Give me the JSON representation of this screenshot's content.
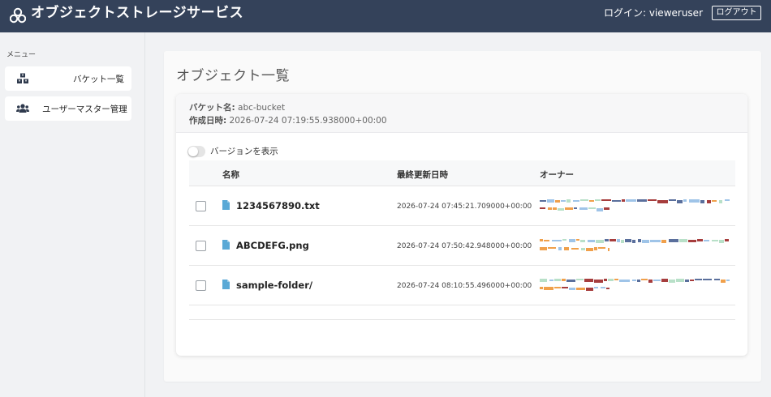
{
  "header": {
    "title": "オブジェクトストレージサービス",
    "login_text": "ログイン: vieweruser",
    "logout_label": "ログアウト",
    "bg_color": "#34425a"
  },
  "sidebar": {
    "menu_label": "メニュー",
    "items": [
      {
        "label": "バケット一覧",
        "icon": "cubes-icon"
      },
      {
        "label": "ユーザーマスター管理",
        "icon": "users-icon"
      }
    ]
  },
  "main": {
    "page_title": "オブジェクト一覧",
    "bucket": {
      "name_label": "バケット名:",
      "name_value": "abc-bucket",
      "created_label": "作成日時:",
      "created_value": "2026-07-24 07:19:55.938000+00:00"
    },
    "version_toggle": {
      "label": "バージョンを表示",
      "on": false
    },
    "table": {
      "columns": [
        "名称",
        "最終更新日時",
        "オーナー"
      ],
      "rows": [
        {
          "name": "1234567890.txt",
          "updated": "2026-07-24 07:45:21.709000+00:00",
          "icon": "file-icon"
        },
        {
          "name": "ABCDEFG.png",
          "updated": "2026-07-24 07:50:42.948000+00:00",
          "icon": "file-icon"
        },
        {
          "name": "sample-folder/",
          "updated": "2026-07-24 08:10:55.496000+00:00",
          "icon": "file-icon"
        }
      ]
    }
  },
  "colors": {
    "accent_icon": "#5aa9d6",
    "redaction_palette": [
      "#f0a04b",
      "#5a6f9c",
      "#9fc4e8",
      "#a63d3d",
      "#b8e0c8"
    ]
  }
}
